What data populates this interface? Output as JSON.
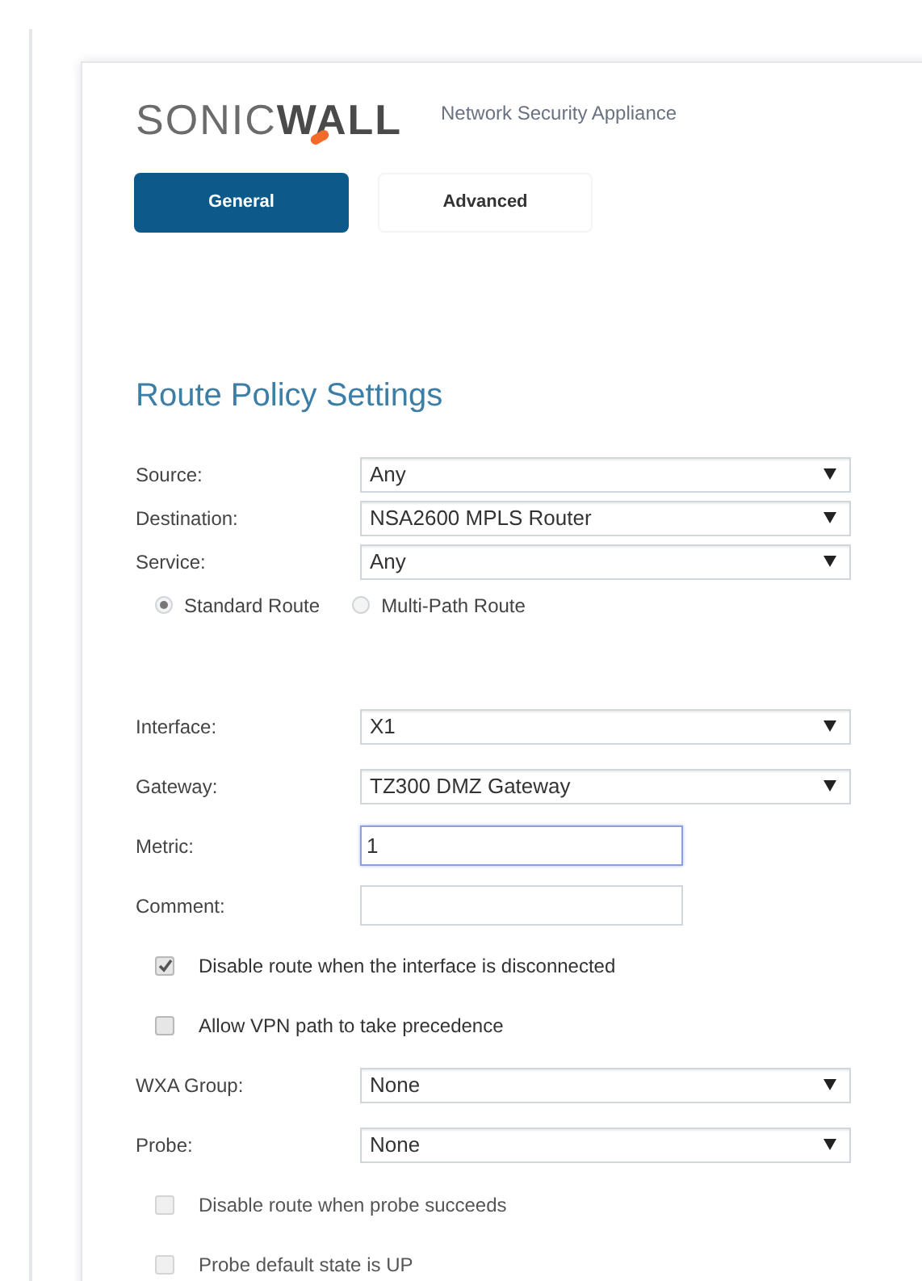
{
  "logo": {
    "light": "SONIC",
    "bold": "WALL"
  },
  "product": "Network Security Appliance",
  "tabs": [
    {
      "label": "General",
      "selected": true
    },
    {
      "label": "Advanced",
      "selected": false
    }
  ],
  "heading": "Route Policy Settings",
  "sections": [
    {
      "rows": [
        {
          "kind": "select",
          "label": "Source:",
          "value": "Any"
        },
        {
          "kind": "select",
          "label": "Destination:",
          "value": "NSA2600 MPLS Router"
        },
        {
          "kind": "select",
          "label": "Service:",
          "value": "Any"
        },
        {
          "kind": "radios",
          "options": [
            {
              "label": "Standard Route",
              "selected": true
            },
            {
              "label": "Multi-Path Route",
              "selected": false
            }
          ]
        }
      ]
    },
    {
      "rows": [
        {
          "kind": "select",
          "label": "Interface:",
          "value": "X1"
        },
        {
          "kind": "select",
          "label": "Gateway:",
          "value": "TZ300 DMZ Gateway"
        },
        {
          "kind": "text",
          "label": "Metric:",
          "value": "1",
          "focused": true
        },
        {
          "kind": "text",
          "label": "Comment:",
          "focused": false
        },
        {
          "kind": "checkbox",
          "label": "Disable route when the interface is disconnected",
          "checked": true,
          "disabled": false
        },
        {
          "kind": "checkbox",
          "label": "Allow VPN path to take precedence",
          "checked": false,
          "disabled": false
        },
        {
          "kind": "select",
          "label": "WXA Group:",
          "value": "None"
        },
        {
          "kind": "select",
          "label": "Probe:",
          "value": "None"
        },
        {
          "kind": "checkbox",
          "label": "Disable route when probe succeeds",
          "checked": false,
          "disabled": true
        },
        {
          "kind": "checkbox",
          "label": "Probe default state is UP",
          "checked": false,
          "disabled": true
        }
      ]
    }
  ]
}
